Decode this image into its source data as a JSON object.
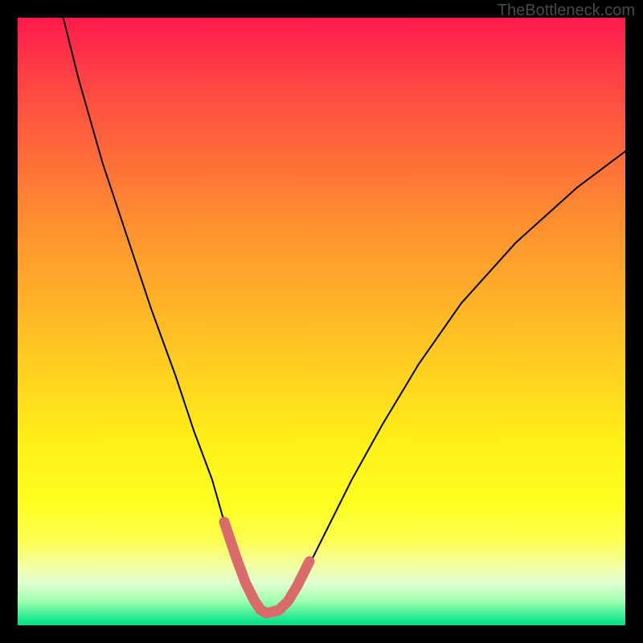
{
  "watermark": "TheBottleneck.com",
  "chart_data": {
    "type": "line",
    "title": "",
    "xlabel": "",
    "ylabel": "",
    "xlim": [
      0,
      100
    ],
    "ylim": [
      0,
      100
    ],
    "note": "Axes are unlabeled; values are estimated normalized percentages (x = horizontal position 0–100, y = curve height 0–100 where 0 is bottom/green and 100 is top/red). The curve depicts a V-shaped bottleneck profile with its minimum near x≈41.",
    "series": [
      {
        "name": "bottleneck-curve",
        "color": "#000000",
        "x": [
          7.5,
          10,
          14,
          18,
          22,
          26,
          29,
          32,
          34,
          36,
          37.5,
          39,
          40,
          41,
          43,
          44.5,
          46,
          48,
          51,
          55,
          60,
          66,
          73,
          82,
          92,
          100
        ],
        "y": [
          100,
          90,
          76,
          64,
          52,
          41,
          32,
          24,
          17,
          11,
          7,
          4,
          2.5,
          2,
          2.5,
          4,
          6.5,
          10,
          16,
          24,
          33,
          43,
          53,
          63,
          72,
          78
        ]
      },
      {
        "name": "optimal-zone-highlight",
        "color": "#d96b6b",
        "x": [
          34,
          35,
          36,
          37.5,
          39,
          40,
          41,
          43,
          44.5,
          46,
          47,
          48
        ],
        "y": [
          17,
          14,
          11,
          7,
          4,
          2.5,
          2,
          2.5,
          4,
          6.5,
          8.5,
          10.5
        ]
      }
    ]
  }
}
